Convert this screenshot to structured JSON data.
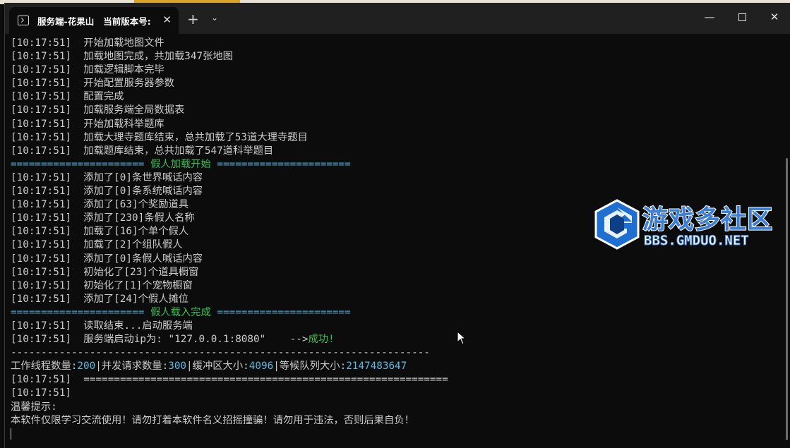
{
  "window": {
    "tab_title": "服务端-花果山   当前版本号:",
    "tab_close": "✕",
    "new_tab": "+",
    "dropdown": "⌄",
    "min": "—",
    "close": "✕"
  },
  "console": {
    "log1": [
      {
        "ts": "[10:17:51]",
        "msg": "开始加载地图文件"
      },
      {
        "ts": "[10:17:51]",
        "msg": "加载地图完成，共加载347张地图"
      },
      {
        "ts": "[10:17:51]",
        "msg": "加载逻辑脚本完毕"
      },
      {
        "ts": "[10:17:51]",
        "msg": "开始配置服务器参数"
      },
      {
        "ts": "[10:17:51]",
        "msg": "配置完成"
      },
      {
        "ts": "[10:17:51]",
        "msg": "加载服务端全局数据表"
      },
      {
        "ts": "[10:17:51]",
        "msg": "开始加载科举题库"
      },
      {
        "ts": "[10:17:51]",
        "msg": "加载大理寺题库结束，总共加载了53道大理寺题目"
      },
      {
        "ts": "[10:17:51]",
        "msg": "加载题库结束，总共加载了547道科举题目"
      }
    ],
    "banner1": {
      "left": "====================== ",
      "text": "假人加载开始",
      "right": " ======================"
    },
    "log2": [
      {
        "ts": "[10:17:51]",
        "msg": "添加了[0]条世界喊话内容"
      },
      {
        "ts": "[10:17:51]",
        "msg": "添加了[0]条系统喊话内容"
      },
      {
        "ts": "[10:17:51]",
        "msg": "添加了[63]个奖励道具"
      },
      {
        "ts": "[10:17:51]",
        "msg": "添加了[230]条假人名称"
      },
      {
        "ts": "[10:17:51]",
        "msg": "加载了[16]个单个假人"
      },
      {
        "ts": "[10:17:51]",
        "msg": "加载了[2]个组队假人"
      },
      {
        "ts": "[10:17:51]",
        "msg": "添加了[0]条假人喊话内容"
      },
      {
        "ts": "[10:17:51]",
        "msg": "初始化了[23]个道具橱窗"
      },
      {
        "ts": "[10:17:51]",
        "msg": "初始化了[1]个宠物橱窗"
      },
      {
        "ts": "[10:17:51]",
        "msg": "添加了[24]个假人摊位"
      }
    ],
    "banner2": {
      "left": "====================== ",
      "text": "假人载入完成",
      "right": " ======================"
    },
    "read_done": {
      "ts": "[10:17:51]",
      "msg": "读取结束...启动服务端"
    },
    "start_line": {
      "ts": "[10:17:51]",
      "msg": "服务端启动ip为: \"127.0.0.1:8080\"    -->",
      "success": "成功!"
    },
    "divider": "---------------------------------------------------------------------",
    "stats": {
      "threads_label": "工作线程数量:",
      "threads": "200",
      "concurrent_label": "|并发请求数量:",
      "concurrent": "300",
      "buffer_label": "|缓冲区大小:",
      "buffer": "4096",
      "queue_label": "|等候队列大小:",
      "queue": "2147483647"
    },
    "end1": {
      "ts": "[10:17:51]",
      "msg": "============================================================"
    },
    "end2": {
      "ts": "[10:17:51]",
      "msg": ""
    },
    "tip_label": "温馨提示:",
    "tip_text": "本软件仅限学习交流使用！请勿打着本软件名义招摇撞骗！请勿用于违法，否则后果自负！"
  },
  "watermark": {
    "cn": "游戏多社区",
    "en": "BBS.GMDUO.NET"
  }
}
